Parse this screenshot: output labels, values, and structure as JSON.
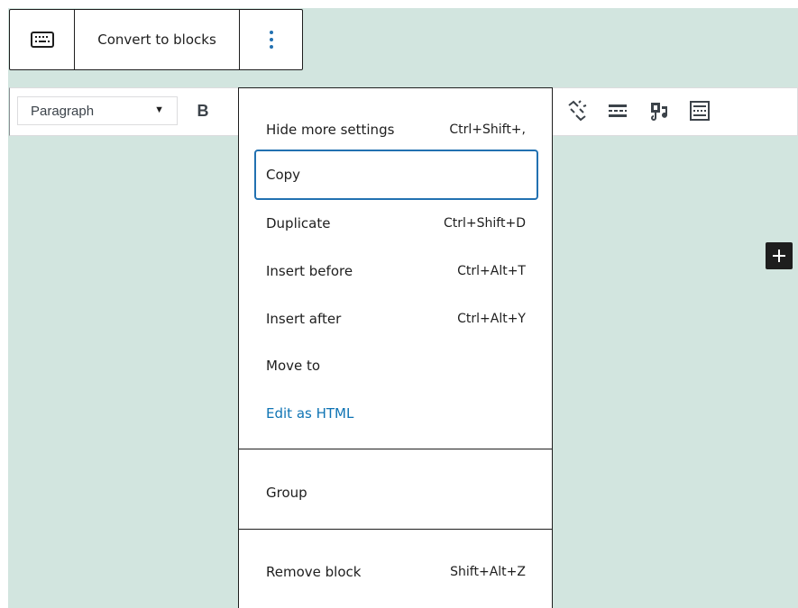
{
  "block_toolbar": {
    "keyboard_icon": "keyboard-icon",
    "convert_label": "Convert to blocks",
    "more_icon": "more-vertical-icon"
  },
  "classic_toolbar": {
    "format_value": "Paragraph",
    "bold_label": "B",
    "icons": [
      "unlink-icon",
      "read-more-icon",
      "add-media-icon",
      "keyboard-shortcuts-icon"
    ]
  },
  "menu": {
    "items": [
      {
        "label": "Hide more settings",
        "shortcut": "Ctrl+Shift+,"
      },
      {
        "label": "Copy",
        "shortcut": ""
      },
      {
        "label": "Duplicate",
        "shortcut": "Ctrl+Shift+D"
      },
      {
        "label": "Insert before",
        "shortcut": "Ctrl+Alt+T"
      },
      {
        "label": "Insert after",
        "shortcut": "Ctrl+Alt+Y"
      },
      {
        "label": "Move to",
        "shortcut": ""
      },
      {
        "label": "Edit as HTML",
        "shortcut": ""
      },
      {
        "label": "Group",
        "shortcut": ""
      },
      {
        "label": "Remove block",
        "shortcut": "Shift+Alt+Z"
      }
    ]
  },
  "add_block_icon": "plus-icon",
  "colors": {
    "canvas": "#d2e5df",
    "focus": "#2271b1",
    "link": "#0f74b4",
    "text": "#1e1e1e"
  }
}
